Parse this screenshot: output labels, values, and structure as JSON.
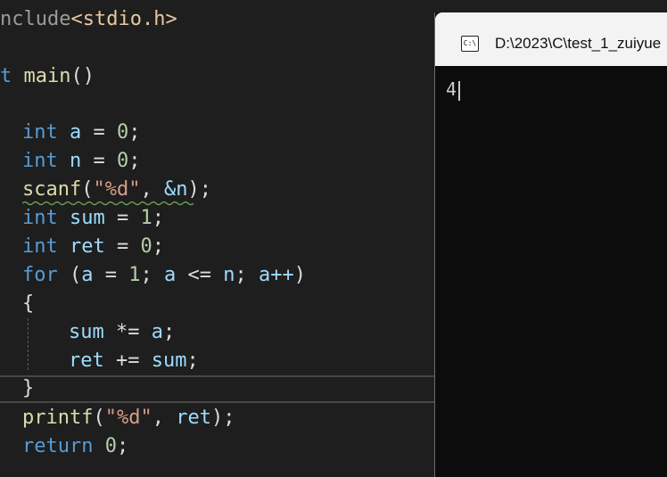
{
  "editor": {
    "lines": [
      {
        "pre": "nclude",
        "inc": "<stdio.h>"
      },
      {
        "kw": "t",
        "fn": "main",
        "punc": "()"
      },
      {
        "kw": "int",
        "id": "a",
        "op": " = ",
        "num": "0",
        "end": ";"
      },
      {
        "kw": "int",
        "id": "n",
        "op": " = ",
        "num": "0",
        "end": ";"
      },
      {
        "fn": "scanf",
        "p1": "(",
        "str": "\"%d\"",
        "p2": ", ",
        "amp": "&n",
        "p3": ");"
      },
      {
        "kw": "int",
        "id": "sum",
        "op": " = ",
        "num": "1",
        "end": ";"
      },
      {
        "kw": "int",
        "id": "ret",
        "op": " = ",
        "num": "0",
        "end": ";"
      },
      {
        "kw": "for",
        "p1": " (",
        "a1": "a",
        "eq": " = ",
        "n1": "1",
        "s1": "; ",
        "a2": "a",
        "le": " <= ",
        "n2": "n",
        "s2": "; ",
        "a3": "a++",
        "p2": ")"
      },
      {
        "punc": "{"
      },
      {
        "id": "sum",
        "op": " *= ",
        "id2": "a",
        "end": ";"
      },
      {
        "id": "ret",
        "op": " += ",
        "id2": "sum",
        "end": ";"
      },
      {
        "punc": "}"
      },
      {
        "fn": "printf",
        "p1": "(",
        "str": "\"%d\"",
        "p2": ", ",
        "id": "ret",
        "p3": ");"
      },
      {
        "kw": "return",
        "sp": " ",
        "num": "0",
        "end": ";"
      }
    ]
  },
  "console": {
    "title": "D:\\2023\\C\\test_1_zuiyue",
    "icon": "C:\\",
    "output": "4"
  },
  "colors": {
    "editor_bg": "#1e1e1e",
    "console_bg": "#0c0c0c",
    "keyword": "#569cd6",
    "identifier": "#9cdcfe",
    "function": "#dcdcaa",
    "number": "#b5cea8",
    "string": "#d69d85",
    "squiggle": "#6a9955"
  }
}
